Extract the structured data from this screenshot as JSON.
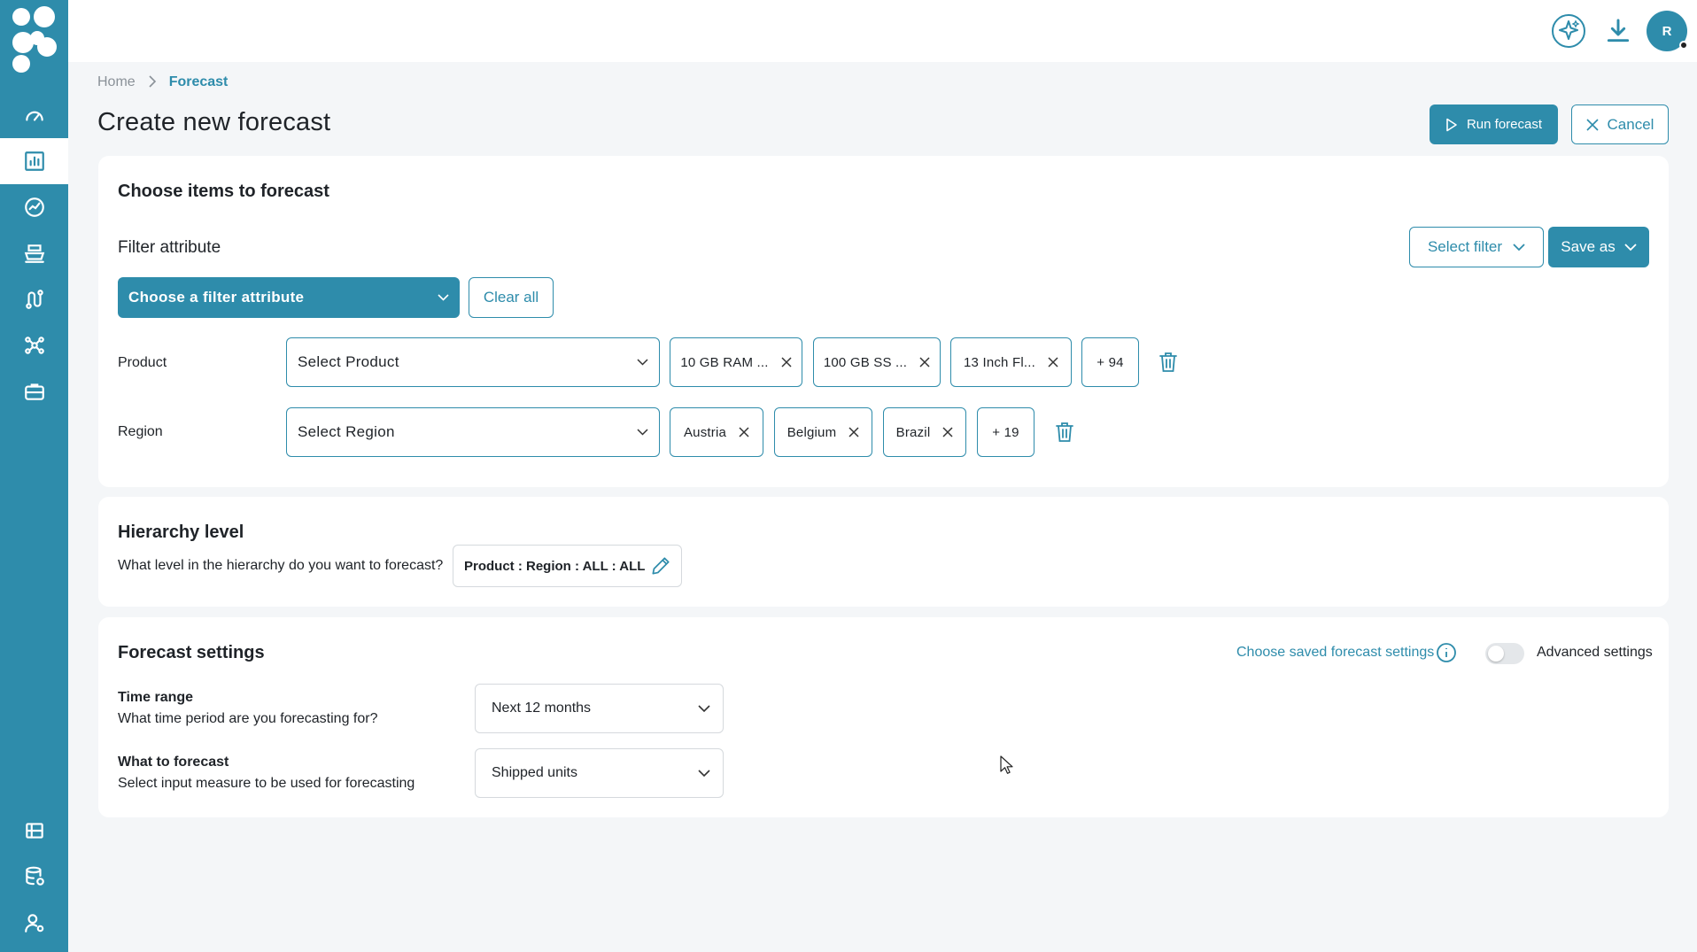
{
  "user": {
    "avatar_initial": "R"
  },
  "breadcrumb": {
    "home": "Home",
    "current": "Forecast"
  },
  "page": {
    "title": "Create new forecast"
  },
  "actions": {
    "run_label": "Run forecast",
    "cancel_label": "Cancel"
  },
  "items_card": {
    "title": "Choose items to forecast",
    "filter_label": "Filter attribute",
    "select_filter_label": "Select filter",
    "save_as_label": "Save as",
    "filter_dropdown_label": "Choose a filter attribute",
    "clear_all_label": "Clear all",
    "product": {
      "label": "Product",
      "placeholder": "Select Product",
      "chips": [
        "10 GB RAM ...",
        "100 GB SS ...",
        "13 Inch Fl..."
      ],
      "more": "+ 94"
    },
    "region": {
      "label": "Region",
      "placeholder": "Select Region",
      "chips": [
        "Austria",
        "Belgium",
        "Brazil"
      ],
      "more": "+ 19"
    }
  },
  "hierarchy": {
    "title": "Hierarchy level",
    "question": "What level in the hierarchy do you want to forecast?",
    "value": "Product : Region : ALL : ALL"
  },
  "settings": {
    "title": "Forecast settings",
    "saved_link": "Choose saved forecast settings",
    "advanced_label": "Advanced settings",
    "advanced_enabled": false,
    "time_range": {
      "title": "Time range",
      "desc": "What time period are you forecasting for?",
      "value": "Next 12 months"
    },
    "what": {
      "title": "What to forecast",
      "desc": "Select input measure to be used for forecasting",
      "value": "Shipped units"
    }
  },
  "colors": {
    "accent": "#2e8cab",
    "background": "#f4f6f8",
    "card": "#ffffff"
  },
  "icons": {
    "sidebar": [
      "dashboard-icon",
      "bar-chart-icon",
      "trend-icon",
      "ship-icon",
      "route-icon",
      "network-icon",
      "briefcase-icon",
      "report-icon",
      "database-settings-icon",
      "user-settings-icon"
    ],
    "topbar": [
      "ai-sparkle-icon",
      "download-icon"
    ]
  }
}
